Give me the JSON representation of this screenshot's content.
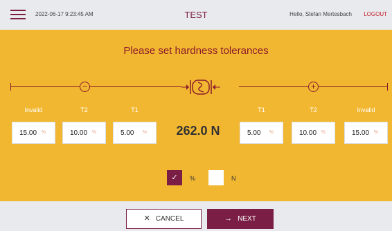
{
  "header": {
    "timestamp": "2022-06-17 9:23:45 AM",
    "title": "TEST",
    "greeting": "Hello, Stefan Mertesbach",
    "logout_label": "LOGOUT"
  },
  "main": {
    "heading": "Please set hardness tolerances",
    "minus_sign": "−",
    "plus_sign": "+",
    "force_value": "262.0 N",
    "left": {
      "invalid": {
        "label": "Invalid",
        "value": "15.00",
        "unit": "%"
      },
      "t2": {
        "label": "T2",
        "value": "10.00",
        "unit": "%"
      },
      "t1": {
        "label": "T1",
        "value": "5.00",
        "unit": "%"
      }
    },
    "right": {
      "t1": {
        "label": "T1",
        "value": "5.00",
        "unit": "%"
      },
      "t2": {
        "label": "T2",
        "value": "10.00",
        "unit": "%"
      },
      "invalid": {
        "label": "Invalid",
        "value": "15.00",
        "unit": "%"
      }
    },
    "units": {
      "percent": {
        "label": "%",
        "checked": true,
        "check_glyph": "✓"
      },
      "newton": {
        "label": "N",
        "checked": false
      }
    }
  },
  "footer": {
    "cancel": {
      "glyph": "✕",
      "label": "CANCEL"
    },
    "next": {
      "glyph": "→",
      "label": "NEXT"
    }
  },
  "colors": {
    "accent": "#7b1e45",
    "panel_background": "#f2b731",
    "heading_text": "#8b1a2a",
    "logout": "#c0202a",
    "chrome_background": "#e9eaee"
  },
  "icons": [
    "hamburger-menu-icon",
    "minus-circle-icon",
    "spring-hardness-icon",
    "plus-circle-icon",
    "checkmark-icon",
    "close-icon",
    "arrow-right-icon"
  ]
}
